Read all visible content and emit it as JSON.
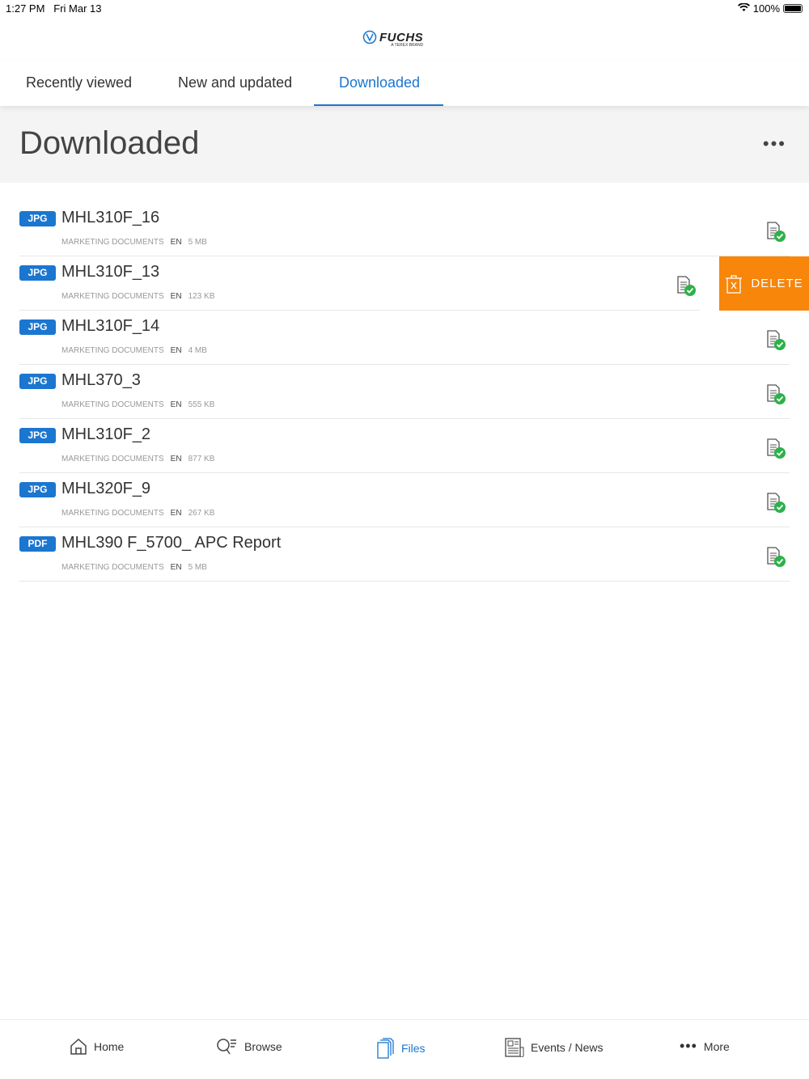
{
  "status": {
    "time": "1:27 PM",
    "date": "Fri Mar 13",
    "battery": "100%",
    "battery_level": 100
  },
  "logo": {
    "word": "FUCHS",
    "sub": "A TEREX BRAND"
  },
  "tabs": [
    {
      "label": "Recently viewed"
    },
    {
      "label": "New and updated"
    },
    {
      "label": "Downloaded"
    }
  ],
  "header": {
    "title": "Downloaded",
    "more": "•••"
  },
  "delete_label": "DELETE",
  "files": [
    {
      "type": "JPG",
      "name": "MHL310F_16",
      "category": "MARKETING DOCUMENTS",
      "lang": "EN",
      "size": "5 MB"
    },
    {
      "type": "JPG",
      "name": "MHL310F_13",
      "category": "MARKETING DOCUMENTS",
      "lang": "EN",
      "size": "123 KB"
    },
    {
      "type": "JPG",
      "name": "MHL310F_14",
      "category": "MARKETING DOCUMENTS",
      "lang": "EN",
      "size": "4 MB"
    },
    {
      "type": "JPG",
      "name": "MHL370_3",
      "category": "MARKETING DOCUMENTS",
      "lang": "EN",
      "size": "555 KB"
    },
    {
      "type": "JPG",
      "name": "MHL310F_2",
      "category": "MARKETING DOCUMENTS",
      "lang": "EN",
      "size": "877 KB"
    },
    {
      "type": "JPG",
      "name": "MHL320F_9",
      "category": "MARKETING DOCUMENTS",
      "lang": "EN",
      "size": "267 KB"
    },
    {
      "type": "PDF",
      "name": "MHL390 F_5700_ APC Report",
      "category": "MARKETING DOCUMENTS",
      "lang": "EN",
      "size": "5 MB"
    }
  ],
  "nav": [
    {
      "label": "Home"
    },
    {
      "label": "Browse"
    },
    {
      "label": "Files"
    },
    {
      "label": "Events / News"
    },
    {
      "label": "More"
    }
  ],
  "colors": {
    "accent": "#1b76d0",
    "delete": "#f7860a",
    "check": "#2db14a"
  }
}
